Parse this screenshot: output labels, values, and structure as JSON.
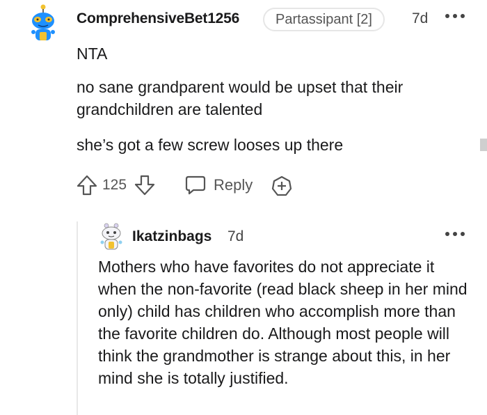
{
  "comment": {
    "author": "ComprehensiveBet1256",
    "flair": "Partassipant [2]",
    "age": "7d",
    "avatar_icon": "snoo-avatar-icon",
    "more_icon": "more-options-icon",
    "paragraphs": [
      "NTA",
      "no sane grandparent would be upset that their grandchildren are talented",
      "she’s got a few screw looses up there"
    ],
    "score": "125",
    "reply_label": "Reply",
    "icons": {
      "upvote": "upvote-arrow-icon",
      "downvote": "downvote-arrow-icon",
      "reply": "speech-bubble-icon",
      "award": "add-award-icon"
    }
  },
  "reply": {
    "author": "Ikatzinbags",
    "age": "7d",
    "avatar_icon": "snoo-avatar-icon",
    "more_icon": "more-options-icon",
    "body": "Mothers who have favorites do not appreciate it when the non-favorite (read black sheep in her mind only) child has children who accomplish more than the favorite children do. Although most people will think the grandmother is strange about this, in her mind she is totally justified."
  },
  "colors": {
    "text": "#1a1a1b",
    "muted": "#555555",
    "avatar_blue": "#1e90ff",
    "avatar_yellow": "#f2c230",
    "thread_line": "#e8e8e8"
  }
}
